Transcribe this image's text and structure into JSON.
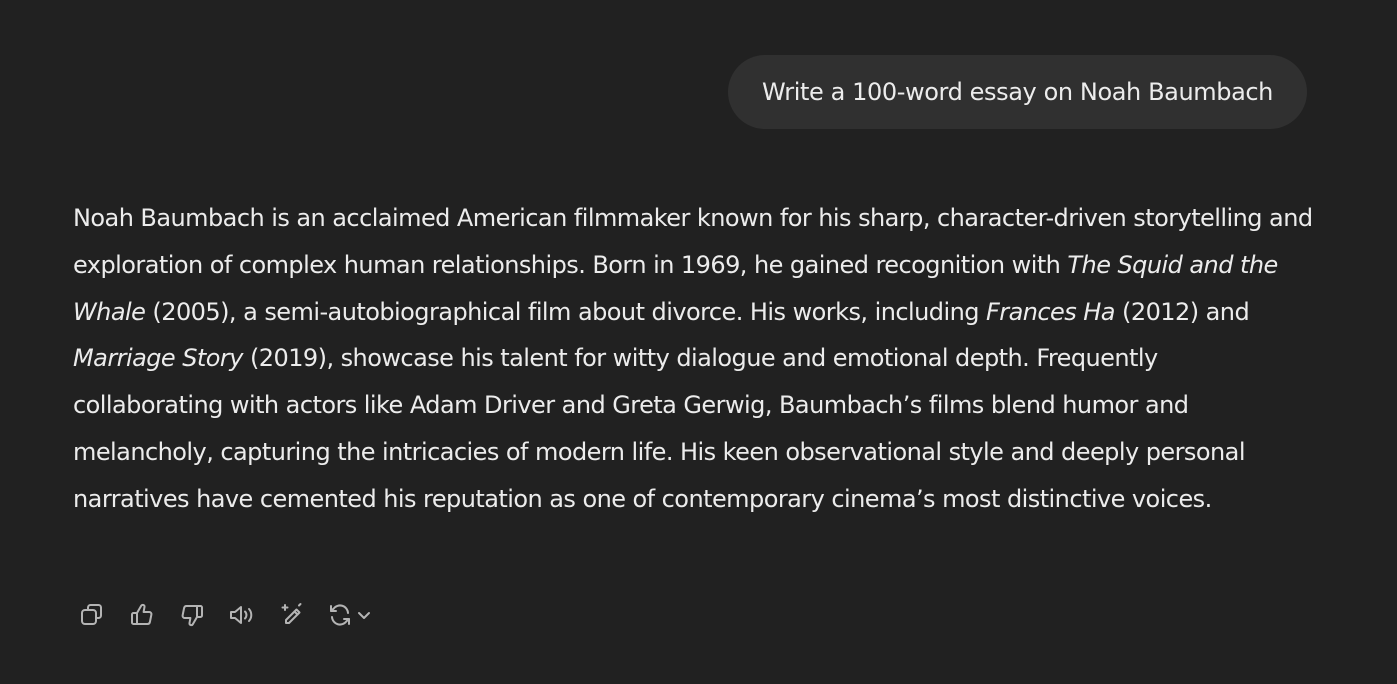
{
  "user_message": {
    "text": "Write a 100-word essay on Noah Baumbach"
  },
  "assistant_message": {
    "segments": [
      {
        "text": "Noah Baumbach is an acclaimed American filmmaker known for his sharp, character-driven storytelling and exploration of complex human relationships. Born in 1969, he gained recognition with ",
        "italic": false
      },
      {
        "text": "The Squid and the Whale",
        "italic": true
      },
      {
        "text": " (2005), a semi-autobiographical film about divorce. His works, including ",
        "italic": false
      },
      {
        "text": "Frances Ha",
        "italic": true
      },
      {
        "text": " (2012) and ",
        "italic": false
      },
      {
        "text": "Marriage Story",
        "italic": true
      },
      {
        "text": " (2019), showcase his talent for witty dialogue and emotional depth. Frequently collaborating with actors like Adam Driver and Greta Gerwig, Baumbach’s films blend humor and melancholy, capturing the intricacies of modern life. His keen observational style and deeply personal narratives have cemented his reputation as one of contemporary cinema’s most distinctive voices.",
        "italic": false
      }
    ]
  },
  "actions": [
    {
      "icon": "copy-icon"
    },
    {
      "icon": "thumbs-up-icon"
    },
    {
      "icon": "thumbs-down-icon"
    },
    {
      "icon": "read-aloud-icon"
    },
    {
      "icon": "edit-sparkle-icon"
    },
    {
      "icon": "regenerate-icon"
    }
  ],
  "colors": {
    "background": "#212121",
    "bubble": "#303030",
    "text": "#ececec",
    "icon": "#b4b4b4"
  }
}
